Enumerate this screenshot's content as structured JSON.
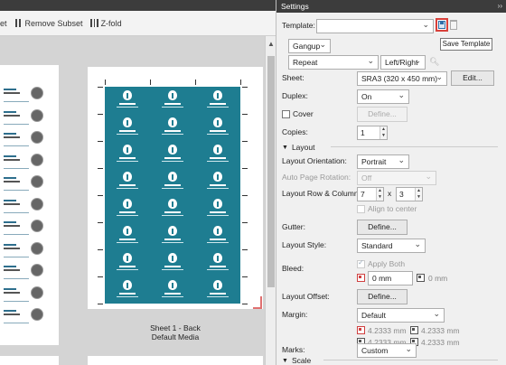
{
  "toolbar": {
    "item_cut": "et",
    "remove_subset_label": "Remove Subset",
    "z_fold_label": "Z-fold"
  },
  "preview": {
    "sheet2_caption_line1": "Sheet 1 - Back",
    "sheet2_caption_line2": "Default Media",
    "sheet2_card_columns": 3,
    "sheet2_card_rows": 8,
    "card_color": "#1e7d91"
  },
  "settings": {
    "title": "Settings",
    "template_label": "Template:",
    "template_value": "",
    "tooltip": "Save Template",
    "gangup_value": "Gangup",
    "repeat_value": "Repeat",
    "alignment_value": "Left/Right",
    "sheet_label": "Sheet:",
    "sheet_value": "SRA3 (320 x 450 mm)",
    "sheet_edit_button": "Edit...",
    "duplex_label": "Duplex:",
    "duplex_value": "On",
    "cover_label": "Cover",
    "cover_define_button": "Define...",
    "copies_label": "Copies:",
    "copies_value": "1",
    "layout_section": "Layout",
    "layout_orientation_label": "Layout Orientation:",
    "layout_orientation_value": "Portrait",
    "auto_page_rotation_label": "Auto Page Rotation:",
    "auto_page_rotation_value": "Off",
    "layout_row_col_label": "Layout Row & Column:",
    "layout_rows_value": "7",
    "layout_x": "x",
    "layout_cols_value": "3",
    "align_to_center_label": "Align to center",
    "gutter_label": "Gutter:",
    "gutter_define_button": "Define...",
    "layout_style_label": "Layout Style:",
    "layout_style_value": "Standard",
    "bleed_label": "Bleed:",
    "apply_both_label": "Apply Both",
    "bleed_value_1": "0 mm",
    "bleed_value_2": "0 mm",
    "layout_offset_label": "Layout Offset:",
    "layout_offset_define_button": "Define...",
    "margin_label": "Margin:",
    "margin_value": "Default",
    "margin_top": "4.2333 mm",
    "margin_right": "4.2333 mm",
    "margin_bottom": "4.2333 mm",
    "margin_left": "4.2333 mm",
    "marks_label": "Marks:",
    "marks_value": "Custom",
    "scale_section": "Scale"
  }
}
